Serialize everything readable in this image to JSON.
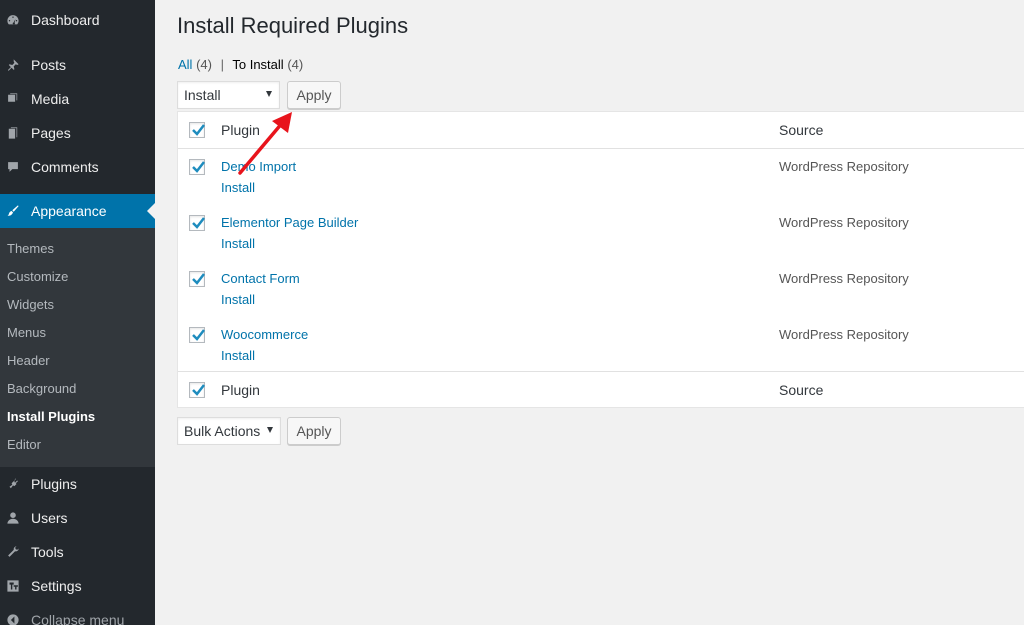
{
  "sidebar": {
    "items": [
      {
        "label": "Dashboard",
        "icon": "dashboard-icon"
      },
      {
        "label": "Posts",
        "icon": "pin-icon"
      },
      {
        "label": "Media",
        "icon": "media-icon"
      },
      {
        "label": "Pages",
        "icon": "pages-icon"
      },
      {
        "label": "Comments",
        "icon": "comment-icon"
      },
      {
        "label": "Appearance",
        "icon": "brush-icon"
      },
      {
        "label": "Plugins",
        "icon": "plug-icon"
      },
      {
        "label": "Users",
        "icon": "user-icon"
      },
      {
        "label": "Tools",
        "icon": "wrench-icon"
      },
      {
        "label": "Settings",
        "icon": "settings-icon"
      }
    ],
    "submenu": [
      "Themes",
      "Customize",
      "Widgets",
      "Menus",
      "Header",
      "Background",
      "Install Plugins",
      "Editor"
    ],
    "collapse_label": "Collapse menu",
    "accent_color": "#0073aa"
  },
  "main": {
    "title": "Install Required Plugins",
    "views": {
      "all_label": "All",
      "all_count": "(4)",
      "separator": "|",
      "to_install_label": "To Install",
      "to_install_count": "(4)"
    },
    "top_bulk_select": "Install",
    "top_apply": "Apply",
    "bottom_bulk_select": "Bulk Actions",
    "bottom_apply": "Apply",
    "table": {
      "columns": [
        "Plugin",
        "Source"
      ],
      "rows": [
        {
          "name": "Demo Import",
          "action": "Install",
          "source": "WordPress Repository"
        },
        {
          "name": "Elementor Page Builder",
          "action": "Install",
          "source": "WordPress Repository"
        },
        {
          "name": "Contact Form",
          "action": "Install",
          "source": "WordPress Repository"
        },
        {
          "name": "Woocommerce",
          "action": "Install",
          "source": "WordPress Repository"
        }
      ]
    }
  }
}
